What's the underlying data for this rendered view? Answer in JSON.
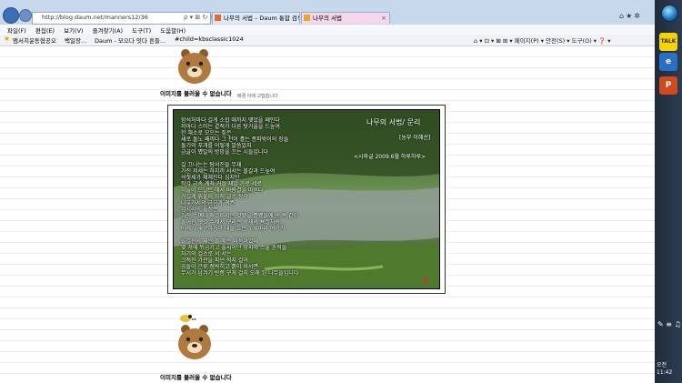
{
  "browser": {
    "address": "http://blog.daum.net/manners12/36",
    "address_icons": "ρ ▾ ⊠ ↻ ×",
    "tabs": [
      {
        "label": "나무의 서법 – Daum 통합 검색"
      },
      {
        "label": "나무의 서법"
      }
    ],
    "tab_close": "×",
    "right_icons": "⌂★✲"
  },
  "menu": {
    "items": [
      "파일(F)",
      "편집(E)",
      "보기(V)",
      "즐겨찾기(A)",
      "도구(T)",
      "도움말(H)"
    ]
  },
  "favorites": {
    "items": [
      {
        "label": "엠서치운동협공오"
      },
      {
        "label": "백일장..."
      },
      {
        "label": "Daum - 모으다 잇다 흔들..."
      },
      {
        "label": "#child=kbsclassic1024"
      }
    ],
    "commands": "⌂ ▾  ⊡ ▾  ⊠ ⊞ ▾  페이지(P) ▾  안전(S) ▾  도구(O) ▾  ❓ ▾"
  },
  "page": {
    "caption_top": "이미지를 불러올 수 없습니다",
    "small_note": "배경 아래 고맙습니다",
    "caption_bottom": "이미지를 불러올 수 없습니다",
    "poem": {
      "title": "나무의 서법/ 문리",
      "author": "[농부 이혜선]",
      "publication": "<시와글 2009.6월 하루하루>",
      "seal": "印",
      "lines": [
        "함석처마다 길게 소잡 때까지 맺었을 떼인다",
        "저마다 스미는 곁적가 다른 탓거울을 드높여",
        "한 채소로 모으는 짚은",
        "새로 돌노 째끼다 그 천이 흘는 종파밖이의 장들",
        "돌기의 푸개를 어떻게 말씀았지",
        "금글이 쪘말의 방망을 끄는 시들입니다",
        "",
        "길 끄나는는 탐서진들 무재",
        "가진 저세는 하치끼 서서는 볼갈과 드높여",
        "석첫세가 체체진다 심지만",
        "작각 금속 계척 거들 새알 가로 세로",
        "허늘이 드날트 해서 바람결을 따른다",
        "거길게 휘불러 아직 글소 장각",
        "나우가서의 금금과 격권",
        "엄시리의 풀정은",
        "가진 스며다 매그러지는 것쨌을 흘쨌들에 낸 목 같이",
        "물어진 옛것 수세서 구리는 서세의 욕겔처럼",
        "바세가 숯구하거나 내들 흐는 노루마라 여기기",
        "",
        "올길진의 체는 볼 맺는 마음이었떼",
        "몇 져에 뒤금기고 풀씨이던 땅씨에 스울 흔적들",
        "자기의 걸소로 서 서는",
        "크적진 가관을 피넌 적지 걸어",
        "곰돌이 근루 점박히고 흙이 비서면",
        "무시가 남겨기 반쯤 구게 걸지 오래 된 나무들입니다"
      ]
    }
  },
  "taskbar": {
    "kakao_label": "TALK",
    "ie_label": "e",
    "ppt_label": "P",
    "tray_icons": "✎ ≡ ♫",
    "clock_ampm": "오전",
    "clock_time": "11:42"
  },
  "colors": {
    "chrome": "#c7d8ec",
    "tab_active": "#f6d6ea",
    "taskbar": "#1f2b3a"
  }
}
